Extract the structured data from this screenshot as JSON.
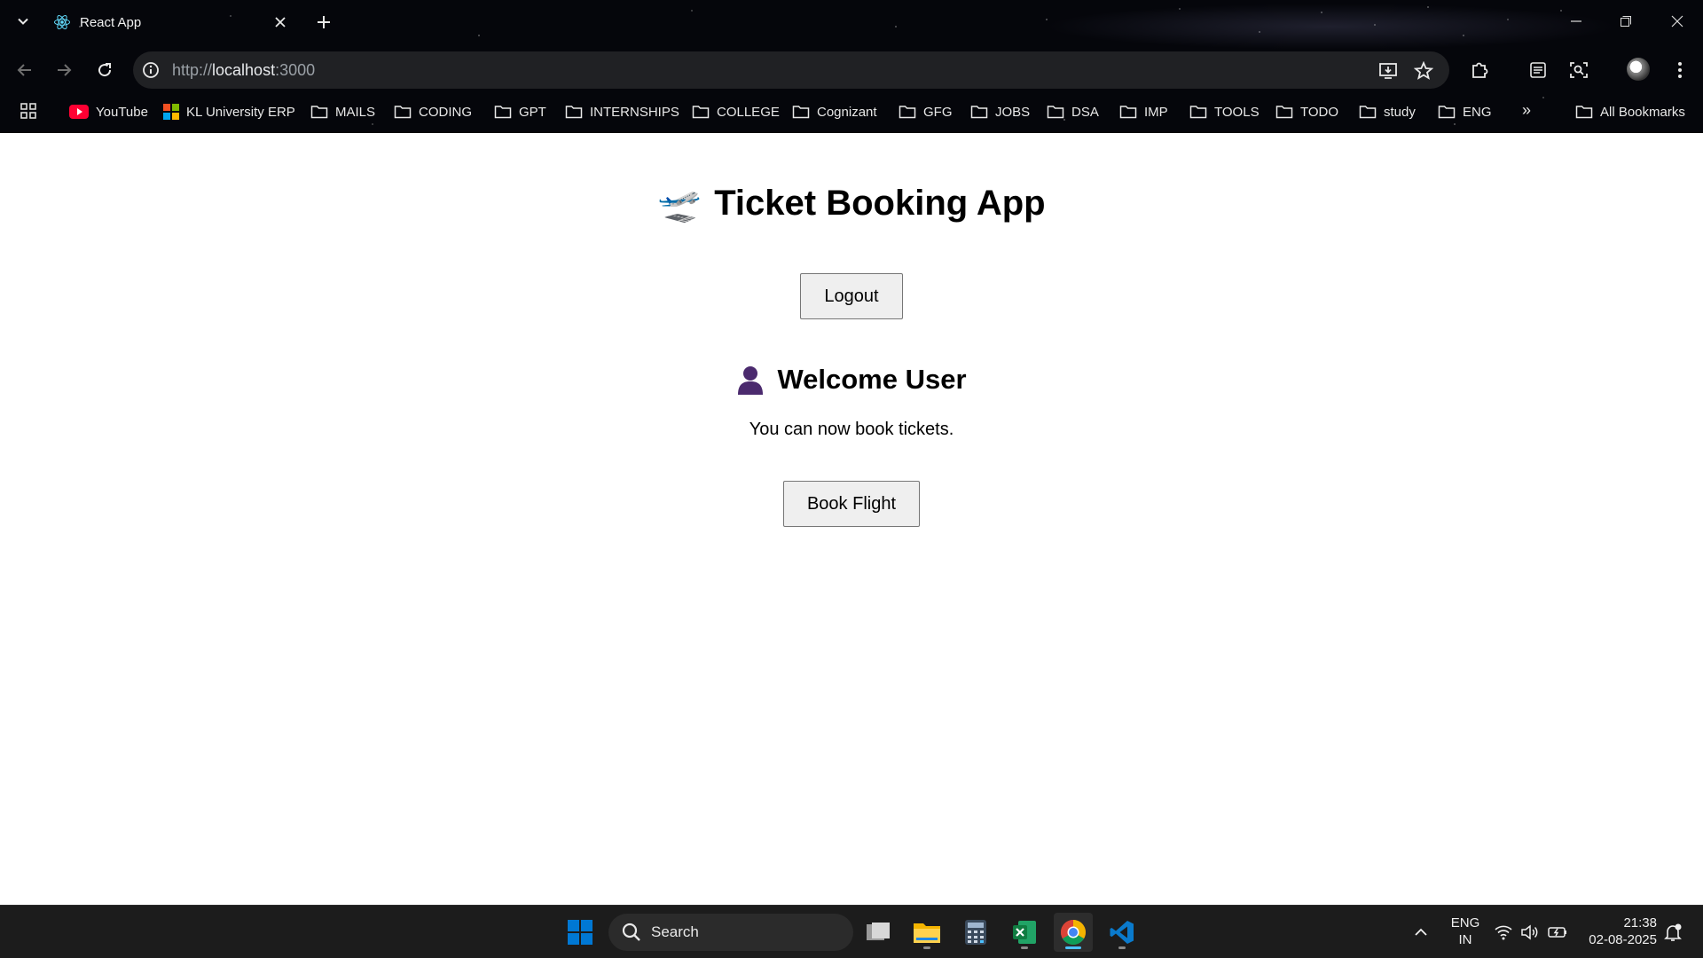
{
  "browser": {
    "tab": {
      "title": "React App"
    },
    "url": {
      "scheme": "http://",
      "host": "localhost",
      "port": ":3000"
    },
    "bookmarks": [
      {
        "label": "YouTube",
        "icon": "youtube-icon"
      },
      {
        "label": "KL University ERP",
        "icon": "erp-icon"
      },
      {
        "label": "MAILS",
        "icon": "folder-icon"
      },
      {
        "label": "CODING",
        "icon": "folder-icon"
      },
      {
        "label": "GPT",
        "icon": "folder-icon"
      },
      {
        "label": "INTERNSHIPS",
        "icon": "folder-icon"
      },
      {
        "label": "COLLEGE",
        "icon": "folder-icon"
      },
      {
        "label": "Cognizant",
        "icon": "folder-icon"
      },
      {
        "label": "GFG",
        "icon": "folder-icon"
      },
      {
        "label": "JOBS",
        "icon": "folder-icon"
      },
      {
        "label": "DSA",
        "icon": "folder-icon"
      },
      {
        "label": "IMP",
        "icon": "folder-icon"
      },
      {
        "label": "TOOLS",
        "icon": "folder-icon"
      },
      {
        "label": "TODO",
        "icon": "folder-icon"
      },
      {
        "label": "study",
        "icon": "folder-icon"
      },
      {
        "label": "ENG",
        "icon": "folder-icon"
      }
    ],
    "more_bookmarks": "»",
    "all_bookmarks": "All Bookmarks"
  },
  "page": {
    "title": "Ticket Booking App",
    "title_emoji": "🛫",
    "logout_label": "Logout",
    "welcome_heading": "Welcome User",
    "welcome_emoji": "👤",
    "welcome_text": "You can now book tickets.",
    "book_label": "Book Flight"
  },
  "taskbar": {
    "search_label": "Search",
    "language": "ENG",
    "region": "IN",
    "time": "21:38",
    "date": "02-08-2025",
    "apps": [
      "windows-start",
      "task-view",
      "file-explorer",
      "calculator",
      "excel",
      "chrome",
      "vscode"
    ],
    "colors": {
      "accent": "#4cc2ff",
      "start_blue": "#0078d4",
      "excel_green": "#107c41",
      "vscode_blue": "#0a7acc"
    }
  }
}
